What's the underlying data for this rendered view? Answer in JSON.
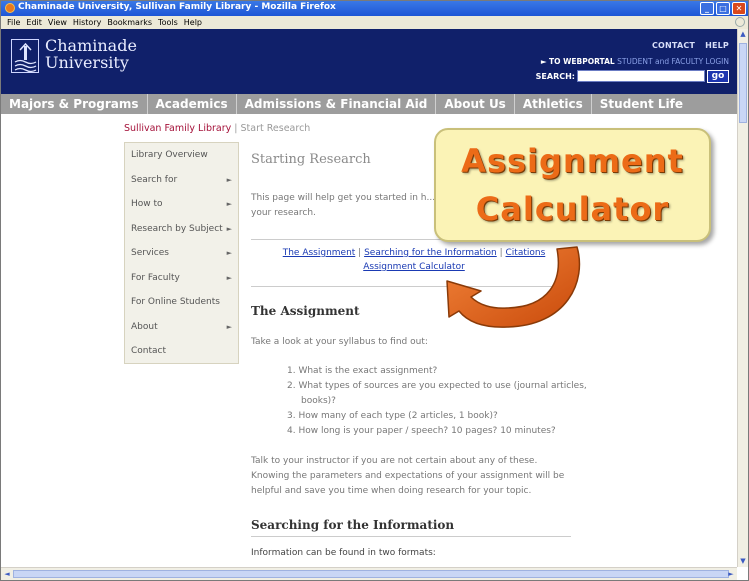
{
  "window": {
    "title": "Chaminade University, Sullivan Family Library - Mozilla Firefox",
    "menu": [
      "File",
      "Edit",
      "View",
      "History",
      "Bookmarks",
      "Tools",
      "Help"
    ]
  },
  "header": {
    "brand_line1": "Chaminade",
    "brand_line2": "University",
    "contact": "CONTACT",
    "help": "HELP",
    "webportal_arrow": "►",
    "webportal": "TO WEBPORTAL",
    "webportal_rest": "STUDENT and FACULTY LOGIN",
    "search_label": "SEARCH:",
    "search_value": "",
    "go": "go"
  },
  "nav": [
    "Majors & Programs",
    "Academics",
    "Admissions & Financial Aid",
    "About Us",
    "Athletics",
    "Student Life"
  ],
  "breadcrumb": {
    "library": "Sullivan Family Library",
    "sep": " | ",
    "current": "Start Research"
  },
  "sidebar": {
    "items": [
      {
        "label": "Library Overview",
        "arrow": ""
      },
      {
        "label": "Search for",
        "arrow": "►"
      },
      {
        "label": "How to",
        "arrow": "►"
      },
      {
        "label": "Research by Subject",
        "arrow": "►"
      },
      {
        "label": "Services",
        "arrow": "►"
      },
      {
        "label": "For Faculty",
        "arrow": "►"
      },
      {
        "label": "For Online Students",
        "arrow": ""
      },
      {
        "label": "About",
        "arrow": "►"
      },
      {
        "label": "Contact",
        "arrow": ""
      }
    ]
  },
  "content": {
    "title": "Starting Research",
    "intro": "This page will help get you started in h... your research.",
    "links": {
      "assignment": "The Assignment",
      "searching": "Searching for the Information",
      "citations": "Citations",
      "calculator": "Assignment Calculator",
      "pipe": " | "
    },
    "assignment_heading": "The Assignment",
    "assignment_intro": "Take a look at your syllabus to find out:",
    "assignment_list": [
      "1.  What is the exact assignment?",
      "2.  What types of sources are you expected to use (journal articles, books)?",
      "3.  How many of each type (2 articles, 1 book)?",
      "4.  How long is your paper / speech? 10 pages? 10 minutes?"
    ],
    "assignment_para": "Talk to your instructor if you are not certain about any of these. Knowing the parameters and expectations of your assignment will be helpful and save you time when doing research for your topic.",
    "searching_heading": "Searching for the Information",
    "searching_intro": "Information can be found in two formats:"
  },
  "callout": {
    "line1": "Assignment",
    "line2": "Calculator"
  },
  "colors": {
    "header_bg": "#10206a",
    "nav_bg": "#9d9d9d",
    "callout_text": "#ec6b17",
    "callout_bg": "#fbf3b6",
    "arrow": "#e8641a"
  }
}
